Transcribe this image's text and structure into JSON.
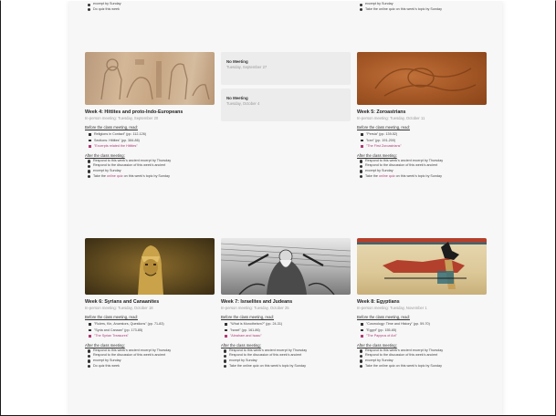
{
  "top_fragments": {
    "left": [
      "excerpt by Sunday",
      "Do quiz this week"
    ],
    "right": [
      "excerpt by Sunday",
      "Take the online quiz on this week's topic by Sunday"
    ]
  },
  "no_meetings": [
    {
      "title": "No Meeting",
      "date": "Tuesday, September 27"
    },
    {
      "title": "No Meeting",
      "date": "Tuesday, October 4"
    }
  ],
  "weeks": [
    {
      "title": "Week 4: Hittites and proto-Indo-Europeans",
      "meeting": "In-person meeting: Tuesday, September 20",
      "before_label": "Before the class meeting, read:",
      "readings": [
        {
          "text": "Religions in Contact\" (pp. 112-126)",
          "pink": false
        },
        {
          "text": "Sections: Hittites\" (pp. 384-86)",
          "pink": false
        },
        {
          "text": "\"Excerpts related the Hittites\"",
          "pink": true
        }
      ],
      "after_label": "After the class meeting:",
      "after": [
        {
          "pre": "Respond to this week's ancient excerpt by Thursday",
          "link": "",
          "post": ""
        },
        {
          "pre": "Respond to the discussion of this week's ancient",
          "link": "",
          "post": ""
        },
        {
          "pre": "excerpt by Sunday",
          "link": "",
          "post": ""
        },
        {
          "pre": "Take the ",
          "link": "online quiz",
          "post": " on this week's topic by Sunday"
        }
      ]
    },
    {
      "title": "Week 5: Zoroastrians",
      "meeting": "In-person meeting: Tuesday, October 11",
      "before_label": "Before the class meeting, read:",
      "readings": [
        {
          "text": "\"Persia\" (pp. 139-52)",
          "pink": false
        },
        {
          "text": "\"Iran\" (pp. 191-200)",
          "pink": false
        },
        {
          "text": "\"The First Zoroastrians\"",
          "pink": true
        }
      ],
      "after_label": "After the class meeting:",
      "after": [
        {
          "pre": "Respond to this week's ancient excerpt by Thursday",
          "link": "",
          "post": ""
        },
        {
          "pre": "Respond to the discussion of this week's ancient",
          "link": "",
          "post": ""
        },
        {
          "pre": "excerpt by Sunday",
          "link": "",
          "post": ""
        },
        {
          "pre": "Take the ",
          "link": "online quiz",
          "post": " on this week's topic by Sunday"
        }
      ]
    },
    {
      "title": "Week 6: Syrians and Canaanites",
      "meeting": "In-person meeting: Tuesday, October 18",
      "before_label": "Before the class meeting, read:",
      "readings": [
        {
          "text": "\"Rulers, Kin, Ancestors, Questions\" (pp. 71-83)",
          "pink": false
        },
        {
          "text": "\"Syria and Canaan\" (pp. 173-85)",
          "pink": false
        },
        {
          "text": "\"The Syrian Treasures\"",
          "pink": true
        }
      ],
      "after_label": "After the class meeting:",
      "after": [
        {
          "pre": "Respond to this week's ancient excerpt by Thursday",
          "link": "",
          "post": ""
        },
        {
          "pre": "Respond to the discussion of this week's ancient",
          "link": "",
          "post": ""
        },
        {
          "pre": "excerpt by Sunday",
          "link": "",
          "post": ""
        },
        {
          "pre": "Do quiz this week",
          "link": "",
          "post": ""
        }
      ]
    },
    {
      "title": "Week 7: Israelites and Judeans",
      "meeting": "In-person meeting: Tuesday, October 25",
      "before_label": "Before the class meeting, read:",
      "readings": [
        {
          "text": "\"What is Monotheism?\" (pp. 24-31)",
          "pink": false
        },
        {
          "text": "\"Israel\" (pp. 161-86)",
          "pink": false
        },
        {
          "text": "\"Abraham and Isaac\"",
          "pink": true
        }
      ],
      "after_label": "After the class meeting:",
      "after": [
        {
          "pre": "Respond to this week's ancient excerpt by Thursday",
          "link": "",
          "post": ""
        },
        {
          "pre": "Respond to the discussion of this week's ancient",
          "link": "",
          "post": ""
        },
        {
          "pre": "excerpt by Sunday",
          "link": "",
          "post": ""
        },
        {
          "pre": "Take the online quiz on this week's topic by Sunday",
          "link": "",
          "post": ""
        }
      ]
    },
    {
      "title": "Week 8: Egyptians",
      "meeting": "In-person meeting: Tuesday, November 1",
      "before_label": "Before the class meeting, read:",
      "readings": [
        {
          "text": "\"Cosmology: Time and History\" (pp. 59-70)",
          "pink": false
        },
        {
          "text": "\"Egypt\" (pp. 155-65)",
          "pink": false
        },
        {
          "text": "\"The Papyrus of Ani\"",
          "pink": true
        }
      ],
      "after_label": "After the class meeting:",
      "after": [
        {
          "pre": "Respond to this week's ancient excerpt by Thursday",
          "link": "",
          "post": ""
        },
        {
          "pre": "Respond to the discussion of this week's ancient",
          "link": "",
          "post": ""
        },
        {
          "pre": "excerpt by Sunday",
          "link": "",
          "post": ""
        },
        {
          "pre": "Take the online quiz on this week's topic by Sunday",
          "link": "",
          "post": ""
        }
      ]
    }
  ]
}
